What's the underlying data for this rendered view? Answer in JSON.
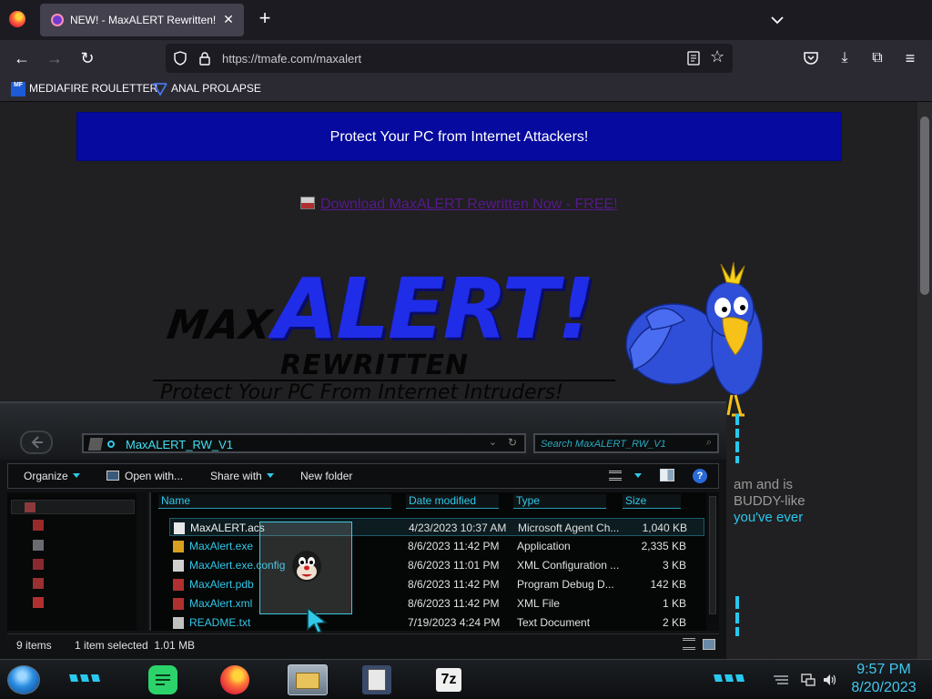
{
  "browser": {
    "tab_title": "NEW! - MaxALERT Rewritten!",
    "url": "https://tmafe.com/maxalert",
    "bookmarks": [
      {
        "label": "MEDIAFIRE ROULETTER",
        "icon": "mediafire-icon"
      },
      {
        "label": "ANAL PROLAPSE",
        "icon": "bookmark-site-icon"
      }
    ]
  },
  "page": {
    "banner_text": "Protect Your PC from Internet Attackers!",
    "download_link": "Download MaxALERT Rewritten Now - FREE!",
    "logo": {
      "max": "MAX",
      "alert": "ALERT!",
      "rewritten": "REWRITTEN",
      "tagline": "Protect Your PC From Internet Intruders!"
    },
    "side_text": {
      "line1": "am and is",
      "line2": "BUDDY-like",
      "line3": "you've ever"
    }
  },
  "explorer": {
    "address": "MaxALERT_RW_V1",
    "search_placeholder": "Search MaxALERT_RW_V1",
    "toolbar": {
      "organize": "Organize",
      "open_with": "Open with...",
      "share_with": "Share with",
      "new_folder": "New folder"
    },
    "columns": [
      "Name",
      "Date modified",
      "Type",
      "Size"
    ],
    "files": [
      {
        "name": "MaxALERT.acs",
        "date": "4/23/2023 10:37 AM",
        "type": "Microsoft Agent Ch...",
        "size": "1,040 KB",
        "selected": true,
        "icon": "agent-character-icon"
      },
      {
        "name": "MaxAlert.exe",
        "date": "8/6/2023 11:42 PM",
        "type": "Application",
        "size": "2,335 KB",
        "selected": false,
        "icon": "application-icon"
      },
      {
        "name": "MaxAlert.exe.config",
        "date": "8/6/2023 11:01 PM",
        "type": "XML Configuration ...",
        "size": "3 KB",
        "selected": false,
        "icon": "config-file-icon"
      },
      {
        "name": "MaxAlert.pdb",
        "date": "8/6/2023 11:42 PM",
        "type": "Program Debug D...",
        "size": "142 KB",
        "selected": false,
        "icon": "pdb-file-icon"
      },
      {
        "name": "MaxAlert.xml",
        "date": "8/6/2023 11:42 PM",
        "type": "XML File",
        "size": "1 KB",
        "selected": false,
        "icon": "xml-file-icon"
      },
      {
        "name": "README.txt",
        "date": "7/19/2023 4:24 PM",
        "type": "Text Document",
        "size": "2 KB",
        "selected": false,
        "icon": "text-file-icon"
      }
    ],
    "status": {
      "item_count": "9 items",
      "selection": "1 item selected  1.01 MB"
    }
  },
  "taskbar": {
    "time": "9:57 PM",
    "date": "8/20/2023",
    "apps": [
      "notes",
      "firefox",
      "file-explorer",
      "agent-app",
      "7-zip"
    ],
    "seven_zip_label": "7z"
  },
  "colors": {
    "banner_bg": "#060a9e",
    "accent_cyan": "#2fc8e8",
    "logo_blue": "#1f2ce8",
    "link_visited": "#551a8b"
  }
}
